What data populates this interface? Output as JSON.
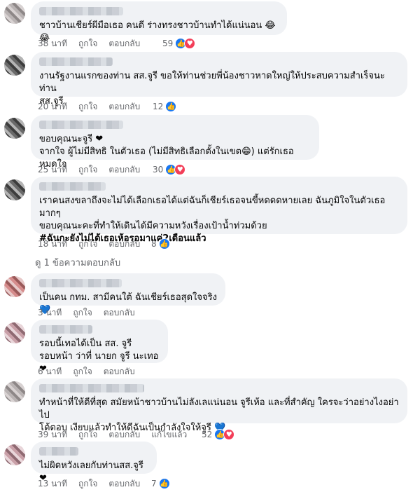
{
  "comments": [
    {
      "text_lines": [
        "ชาวบ้านเชียร์ผีมือเธอ คนดี ร่างทรงชาวบ้านทำได้แน่นอน 😂😂"
      ],
      "time": "38 นาที",
      "like": "ถูกใจ",
      "reply": "ตอบกลับ",
      "reaction_count": "59"
    },
    {
      "text_lines": [
        "งานรัฐงานแรกของท่าน สส.จูรี ขอให้ท่านช่วยพี่น้องชาวหาดใหญ่ให้ประสบความสำเร็จนะท่าน",
        "สส.จูรี"
      ],
      "time": "20 นาที",
      "like": "ถูกใจ",
      "reply": "ตอบกลับ",
      "reaction_count": "12"
    },
    {
      "text_lines": [
        "ขอบคุณนะจูรี ❤",
        "จากใจ ผู้ไม่มีสิทธิ ในตัวเธอ (ไม่มีสิทธิเลือกตั้งในเขต😁) แต่รักเธอหมดใจ"
      ],
      "time": "25 นาที",
      "like": "ถูกใจ",
      "reply": "ตอบกลับ",
      "reaction_count": "30"
    },
    {
      "text_lines": [
        "เราคนสงขลาถึงจะไม่ได้เลือกเธอได้แต่ฉันก็เชียร์เธอจนขี้หดดดหายเลย ฉันภูมิใจในตัวเธอมากๆ",
        "ขอบคุณนะคะที่ทำให้เดินได้มีความหวังเรื่องเป้าน้ำท่วมด้วย",
        "#ฉันกะยังไม่ได้เธอเห้อรอมาแค่2เดือนแล้ว"
      ],
      "time": "18 นาที",
      "like": "ถูกใจ",
      "reply": "ตอบกลับ",
      "reaction_count": "8",
      "view_replies": "ดู 1 ข้อความตอบกลับ"
    },
    {
      "text_lines": [
        "เป็นคน กทม. สามีคนใต้ ฉันเชียร์เธอสุดใจจริง 💙"
      ],
      "time": "3 นาที",
      "like": "ถูกใจ",
      "reply": "ตอบกลับ",
      "reaction_count": ""
    },
    {
      "text_lines": [
        "รอบนี้เทอได้เป็น สส. จูรี",
        "รอบหน้า ว่าที่ นายก จูรี นะเทอ❤"
      ],
      "time": "6 นาที",
      "like": "ถูกใจ",
      "reply": "ตอบกลับ",
      "reaction_count": ""
    },
    {
      "text_lines": [
        "ทำหน้าที่ให้ดีที่สุด สมัยหน้าชาวบ้านไม่ลังเลแน่นอน จูรีเห้อ และที่สำคัญ ใครจะว่าอย่างไงอย่าไป",
        "โต้ตอบ เงียบแล้วทำให้ดีฉันเป็นกำลังใจให้จูรี 💙"
      ],
      "time": "39 นาที",
      "like": "ถูกใจ",
      "reply": "ตอบกลับ",
      "edited": "แก้ไขแล้ว",
      "reaction_count": "52"
    },
    {
      "text_lines": [
        "ไม่ผิดหวังเลยกับท่านสส.จูรี❤"
      ],
      "time": "13 นาที",
      "like": "ถูกใจ",
      "reply": "ตอบกลับ",
      "reaction_count": "7"
    }
  ],
  "icons": {
    "like": "like-icon",
    "love": "love-icon"
  },
  "colors": {
    "like": "#1877f2",
    "love": "#f33e58",
    "bubble": "#f0f2f5",
    "meta": "#65676b"
  }
}
